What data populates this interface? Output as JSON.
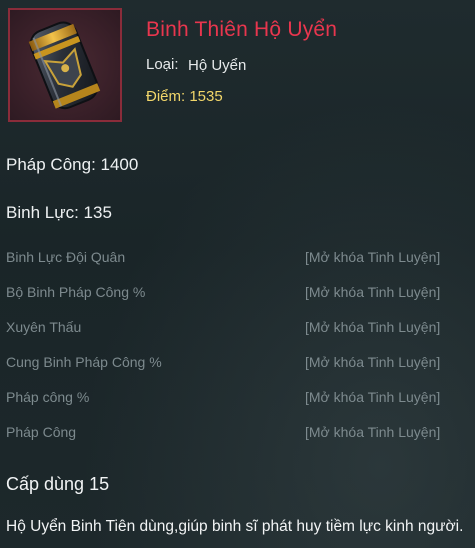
{
  "item": {
    "name": "Binh Thiên Hộ Uyển",
    "type_label": "Loại:",
    "type_value": "Hộ Uyển",
    "score": "Điểm: 1535",
    "icon": "bracer-icon"
  },
  "stats": {
    "main": [
      {
        "text": "Pháp Công: 1400"
      },
      {
        "text": "Binh Lực: 135"
      }
    ],
    "locked": [
      {
        "name": "Binh Lực Đội Quân",
        "status": "[Mở khóa Tinh Luyện]"
      },
      {
        "name": "Bộ Binh Pháp Công %",
        "status": "[Mở khóa Tinh Luyện]"
      },
      {
        "name": "Xuyên Thấu",
        "status": "[Mở khóa Tinh Luyện]"
      },
      {
        "name": "Cung Binh Pháp Công %",
        "status": "[Mở khóa Tinh Luyện]"
      },
      {
        "name": "Pháp công %",
        "status": "[Mở khóa Tinh Luyện]"
      },
      {
        "name": "Pháp Công",
        "status": "[Mở khóa Tinh Luyện]"
      }
    ]
  },
  "requirement": "Cấp dùng 15",
  "description": "Hộ Uyển Binh Tiên dùng,giúp binh sĩ phát huy tiềm lực kinh người.",
  "colors": {
    "item_name": "#e8364e",
    "score": "#f1d66a",
    "locked_text": "#7d8a8e",
    "frame_border": "#8a2c3a"
  }
}
